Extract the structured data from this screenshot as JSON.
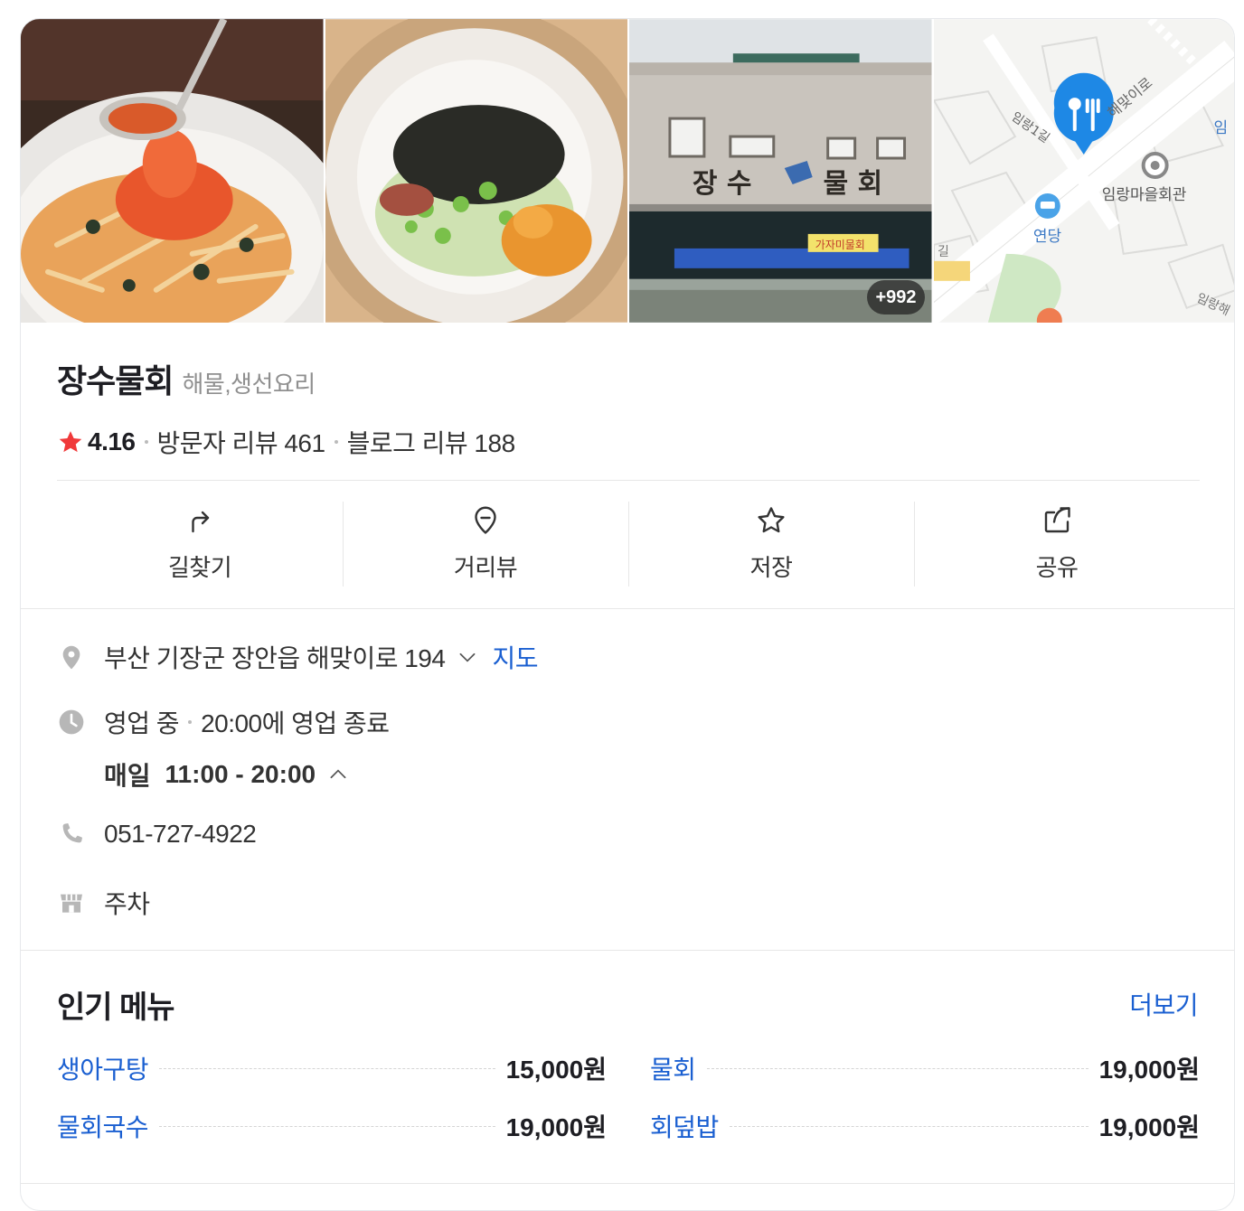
{
  "photos": {
    "more_count": "+992",
    "map_labels": {
      "road1": "해맞이로",
      "road2": "임랑1길",
      "poi": "임랑마을회관",
      "poi2": "연당",
      "edge1": "임",
      "edge2": "임랑해",
      "edge3": "길"
    },
    "sign_text": "장수물회",
    "banner_text": "가자미물회"
  },
  "place": {
    "name": "장수물회",
    "category": "해물,생선요리",
    "rating": "4.16",
    "visitor_reviews": "방문자 리뷰 461",
    "blog_reviews": "블로그 리뷰 188"
  },
  "actions": [
    {
      "label": "길찾기",
      "icon": "directions-icon"
    },
    {
      "label": "거리뷰",
      "icon": "streetview-pin-icon"
    },
    {
      "label": "저장",
      "icon": "star-outline-icon"
    },
    {
      "label": "공유",
      "icon": "share-icon"
    }
  ],
  "info": {
    "address": "부산 기장군 장안읍 해맞이로 194",
    "map_link": "지도",
    "status": "영업 중",
    "close_note": "20:00에 영업 종료",
    "hours_day": "매일",
    "hours_time": "11:00 - 20:00",
    "phone": "051-727-4922",
    "parking": "주차"
  },
  "menu": {
    "title": "인기 메뉴",
    "more": "더보기",
    "items": [
      {
        "name": "생아구탕",
        "price": "15,000원"
      },
      {
        "name": "물회",
        "price": "19,000원"
      },
      {
        "name": "물회국수",
        "price": "19,000원"
      },
      {
        "name": "회덮밥",
        "price": "19,000원"
      }
    ]
  },
  "colors": {
    "accent_blue": "#1a5fd1",
    "star_red": "#f0393a",
    "map_pin": "#1e88e5"
  }
}
